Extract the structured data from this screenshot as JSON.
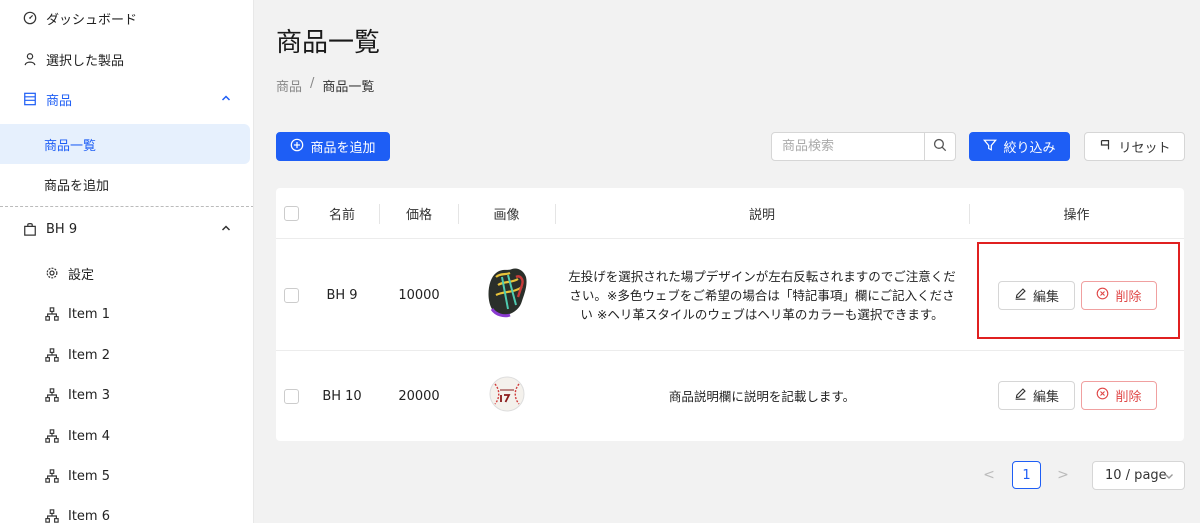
{
  "sidebar": {
    "items": [
      {
        "label": "ダッシュボード",
        "icon": "dashboard-icon"
      },
      {
        "label": "選択した製品",
        "icon": "user-icon"
      },
      {
        "label": "商品",
        "icon": "list-icon"
      },
      {
        "label": "商品一覧"
      },
      {
        "label": "商品を追加"
      },
      {
        "label": "BH 9",
        "icon": "bag-icon"
      },
      {
        "label": "設定",
        "icon": "gear-icon"
      },
      {
        "label": "Item 1",
        "icon": "hierarchy-icon"
      },
      {
        "label": "Item 2",
        "icon": "hierarchy-icon"
      },
      {
        "label": "Item 3",
        "icon": "hierarchy-icon"
      },
      {
        "label": "Item 4",
        "icon": "hierarchy-icon"
      },
      {
        "label": "Item 5",
        "icon": "hierarchy-icon"
      },
      {
        "label": "Item 6",
        "icon": "hierarchy-icon"
      }
    ]
  },
  "page": {
    "title": "商品一覧",
    "breadcrumb": [
      "商品",
      "/",
      "商品一覧"
    ]
  },
  "toolbar": {
    "add_label": "商品を追加",
    "search_placeholder": "商品検索",
    "filter_label": "絞り込み",
    "reset_label": "リセット"
  },
  "table": {
    "headers": [
      "名前",
      "価格",
      "画像",
      "説明",
      "操作"
    ],
    "rows": [
      {
        "name": "BH 9",
        "price": "10000",
        "description": "左投げを選択された場プデザインが左右反転されますのでご注意ください。※多色ウェブをご希望の場合は「特記事項」欄にご記入ください ※ヘリ革スタイルのウェブはヘリ革のカラーも選択できます。",
        "edit_label": "編集",
        "delete_label": "削除"
      },
      {
        "name": "BH 10",
        "price": "20000",
        "description": "商品説明欄に説明を記載します。",
        "edit_label": "編集",
        "delete_label": "削除"
      }
    ]
  },
  "pagination": {
    "prev": "<",
    "current": "1",
    "next": ">",
    "page_size": "10 / page"
  },
  "colors": {
    "primary": "#1e5ef5",
    "danger": "#e04848",
    "highlight": "#e02020"
  }
}
